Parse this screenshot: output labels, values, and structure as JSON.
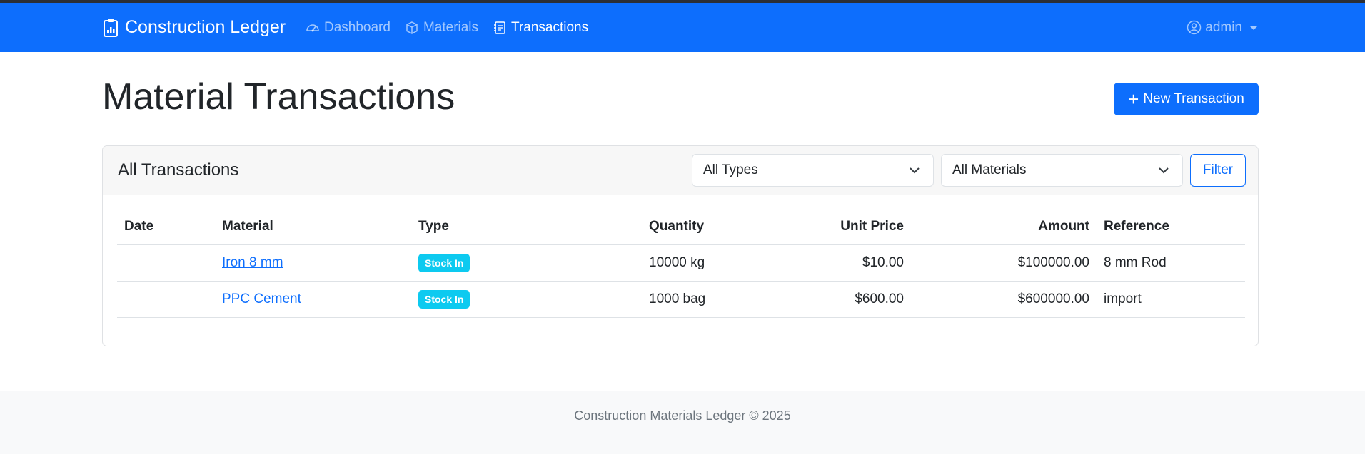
{
  "nav": {
    "brand": "Construction Ledger",
    "links": [
      {
        "label": "Dashboard",
        "active": false
      },
      {
        "label": "Materials",
        "active": false
      },
      {
        "label": "Transactions",
        "active": true
      }
    ],
    "user": "admin"
  },
  "page": {
    "title": "Material Transactions",
    "new_button": "New Transaction"
  },
  "card": {
    "title": "All Transactions",
    "type_filter": "All Types",
    "material_filter": "All Materials",
    "filter_button": "Filter"
  },
  "table": {
    "headers": [
      "Date",
      "Material",
      "Type",
      "Quantity",
      "Unit Price",
      "Amount",
      "Reference"
    ],
    "rows": [
      {
        "date": "",
        "material": "Iron 8 mm",
        "type": "Stock In",
        "quantity": "10000 kg",
        "unit_price": "$10.00",
        "amount": "$100000.00",
        "reference": "8 mm Rod"
      },
      {
        "date": "",
        "material": "PPC Cement",
        "type": "Stock In",
        "quantity": "1000 bag",
        "unit_price": "$600.00",
        "amount": "$600000.00",
        "reference": "import"
      }
    ]
  },
  "footer": {
    "text": "Construction Materials Ledger © 2025"
  },
  "colors": {
    "primary": "#0d6efd",
    "badge_info": "#0dcaf0"
  }
}
